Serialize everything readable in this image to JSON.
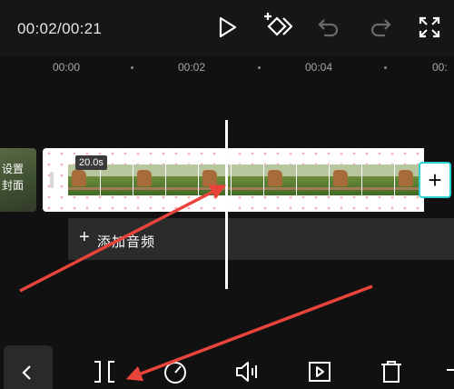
{
  "player": {
    "time_display": "00:02/00:21"
  },
  "toolbar": {
    "play": "play-icon",
    "keyframe": "keyframe-add-icon",
    "undo": "undo-icon",
    "redo": "redo-icon",
    "fullscreen": "fullscreen-icon"
  },
  "ruler": {
    "labels": [
      "00:00",
      "00:02",
      "00:04",
      "00:"
    ]
  },
  "cover": {
    "line1": "设置",
    "line2": "封面"
  },
  "clip": {
    "duration": "20.0s",
    "add_symbol": "+"
  },
  "audio_track": {
    "plus": "+",
    "label": "添加音频"
  },
  "bottom_toolbar": {
    "items": [
      "back-icon",
      "split-icon",
      "speed-icon",
      "volume-icon",
      "animation-icon",
      "delete-icon"
    ]
  },
  "colors": {
    "accent_arrow": "#e8443a",
    "clip_border": "#2bd3d3",
    "background": "#111111"
  }
}
